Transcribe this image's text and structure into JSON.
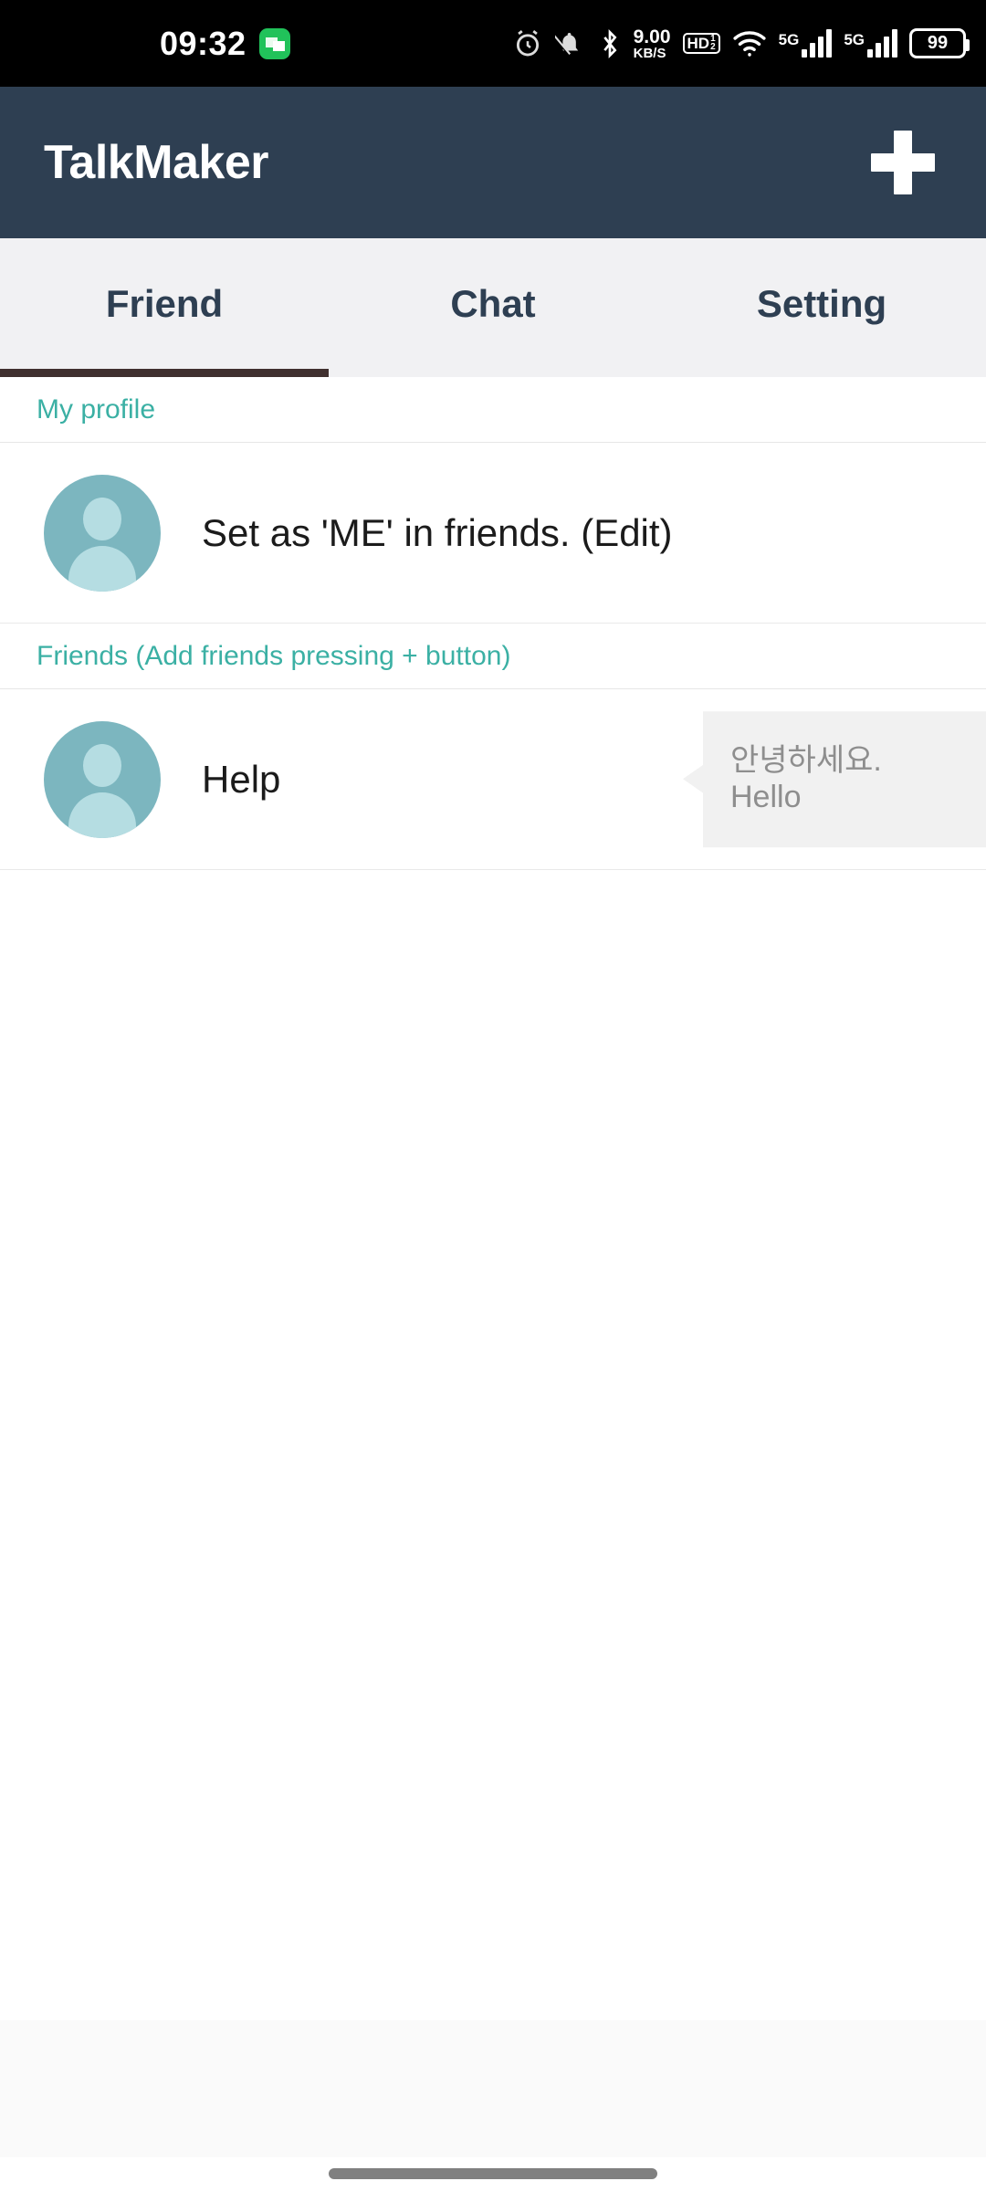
{
  "status_bar": {
    "time": "09:32",
    "notification_icon": "chat-message-icon",
    "alarm_icon": "alarm-clock-icon",
    "mute_icon": "bell-muted-icon",
    "bluetooth_icon": "bluetooth-icon",
    "network_speed_value": "9.00",
    "network_speed_unit": "KB/S",
    "hd_label": "HD",
    "hd_sup": "1",
    "hd_sub": "2",
    "wifi_icon": "wifi-icon",
    "sim1_label": "5G",
    "sim2_label": "5G",
    "battery_level": "99"
  },
  "app_bar": {
    "title": "TalkMaker",
    "add_button_label": "+",
    "background_color": "#2e3f52"
  },
  "tabs": [
    {
      "label": "Friend",
      "active": true
    },
    {
      "label": "Chat",
      "active": false
    },
    {
      "label": "Setting",
      "active": false
    }
  ],
  "tab_indicator_color": "#40302f",
  "accent_color": "#3bb0a4",
  "avatar_color": "#7cb6bf",
  "sections": [
    {
      "header": "My profile",
      "rows": [
        {
          "name": "Set as 'ME' in friends. (Edit)",
          "avatar": "default-person-avatar",
          "bubble": null
        }
      ]
    },
    {
      "header": "Friends (Add friends pressing + button)",
      "rows": [
        {
          "name": "Help",
          "avatar": "default-person-avatar",
          "bubble": "안녕하세요. Hello"
        }
      ]
    }
  ],
  "navigation": {
    "home_pill": "home-gesture-pill"
  }
}
